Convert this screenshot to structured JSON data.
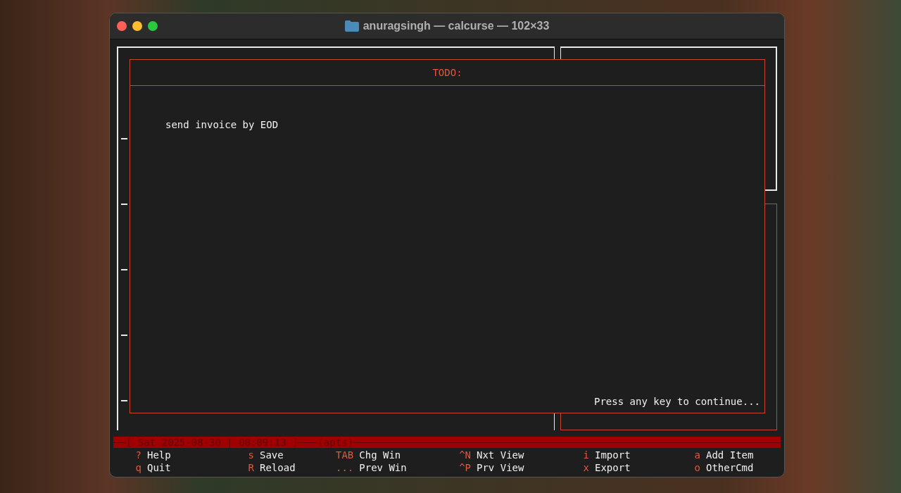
{
  "window": {
    "title": "anuragsingh — calcurse — 102×33"
  },
  "popup": {
    "title": "TODO:",
    "item": "send invoice by EOD",
    "prompt": "Press any key to continue..."
  },
  "status_bar": {
    "date_time": "[ Sat 2025-08-30 | 08:09:13 ]",
    "view": "(apts)"
  },
  "help": [
    {
      "key": "?",
      "label": "Help"
    },
    {
      "key": "s",
      "label": "Save"
    },
    {
      "key": "TAB",
      "label": "Chg Win"
    },
    {
      "key": "^N",
      "label": "Nxt View"
    },
    {
      "key": "i",
      "label": "Import"
    },
    {
      "key": "a",
      "label": "Add Item"
    },
    {
      "key": "q",
      "label": "Quit"
    },
    {
      "key": "R",
      "label": "Reload"
    },
    {
      "key": "...",
      "label": "Prev Win"
    },
    {
      "key": "^P",
      "label": "Prv View"
    },
    {
      "key": "x",
      "label": "Export"
    },
    {
      "key": "o",
      "label": "OtherCmd"
    }
  ]
}
